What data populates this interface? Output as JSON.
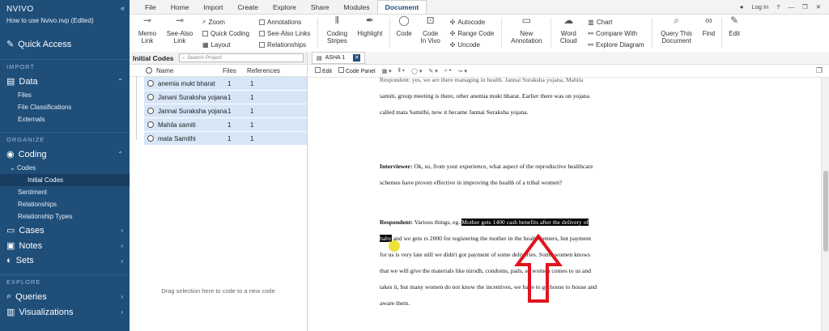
{
  "sidebar": {
    "brand": "NVIVO",
    "project_name": "How to use Nvivo.nvp (Edited)",
    "quick_access": "Quick Access",
    "sections": {
      "import": "IMPORT",
      "organize": "ORGANIZE",
      "explore": "EXPLORE"
    },
    "data": {
      "label": "Data",
      "items": [
        "Files",
        "File Classifications",
        "Externals"
      ]
    },
    "coding": {
      "label": "Coding",
      "codes": "Codes",
      "initial_codes": "Initial Codes",
      "items": [
        "Sentiment",
        "Relationships",
        "Relationship Types"
      ]
    },
    "cases": "Cases",
    "notes": "Notes",
    "sets": "Sets",
    "queries": "Queries",
    "visualizations": "Visualizations"
  },
  "ribbon": {
    "tabs": [
      "File",
      "Home",
      "Import",
      "Create",
      "Explore",
      "Share",
      "Modules",
      "Document"
    ],
    "active_tab": "Document",
    "right": [
      "Log In",
      "?"
    ],
    "memo_link": "Memo Link",
    "see_also_link": "See-Also Link",
    "zoom": "Zoom",
    "quick_coding": "Quick Coding",
    "layout": "Layout",
    "annotations": "Annotations",
    "see_also_links": "See-Also Links",
    "relationships": "Relationships",
    "coding_stripes": "Coding Stripes",
    "highlight": "Highlight",
    "code": "Code",
    "code_in_vivo": "Code In Vivo",
    "autocode": "Autocode",
    "range_code": "Range Code",
    "uncode": "Uncode",
    "new_annotation": "New Annotation",
    "word_cloud": "Word Cloud",
    "chart": "Chart",
    "compare_with": "Compare With",
    "explore_diagram": "Explore Diagram",
    "query_this_document": "Query This Document",
    "find": "Find",
    "edit": "Edit"
  },
  "codes_panel": {
    "title": "Initial Codes",
    "search_placeholder": "Search Project",
    "headers": {
      "name": "Name",
      "files": "Files",
      "references": "References"
    },
    "rows": [
      {
        "name": "anemia mukt bharat",
        "files": "1",
        "references": "1"
      },
      {
        "name": "Janani Suraksha yojana",
        "files": "1",
        "references": "1"
      },
      {
        "name": "Jannai Suraksha yojana",
        "files": "1",
        "references": "1"
      },
      {
        "name": "Mahila samiti",
        "files": "1",
        "references": "1"
      },
      {
        "name": "mata Samithi",
        "files": "1",
        "references": "1"
      }
    ],
    "drag_hint": "Drag selection here to code to a new code"
  },
  "document": {
    "tab": "ASHA 1",
    "edit": "Edit",
    "code_panel": "Code Panel",
    "paragraphs": {
      "p1_line0": "Respondent: yes, we are there managing in health. Jannai Suraksha yojana, Mahila",
      "p1_line1": "samiti, group meeting is there, other anemia mukt bharat. Earlier there was on yojana",
      "p1_line2": "called mata Samithi, now it became Jannai Suraksha yojana.",
      "q_label": "Interviewer:",
      "q_line1": " Ok, so, from your experience, what aspect of the reproductive healthcare",
      "q_line2": "schemes have proven effective in improving the health of a tribal women?",
      "r_label": "Respondent:",
      "r_pre": " Various things, eg.",
      "r_hl1": "Mother gets 1400 cash benefits after the delivery of",
      "r_hl2": "baby",
      "r_line2_rest": " and we gets rs 2000 for registering the mother in the health centers, but payment",
      "r_line3": "for us is very late still we didn't got payment of some deliveries. Some women knows",
      "r_line4": "that we will give the materials like nirodh, condoms, pads, so women comes to us and",
      "r_line5": "takes it, but many women do not know the incentives, we have to go house to house and",
      "r_line6": "aware them."
    }
  },
  "colors": {
    "sidebar": "#1f4e79",
    "row_selected": "#d6e6f7",
    "highlight": "#000000",
    "arrow": "#e0141e",
    "cursor": "#ebdc14"
  }
}
